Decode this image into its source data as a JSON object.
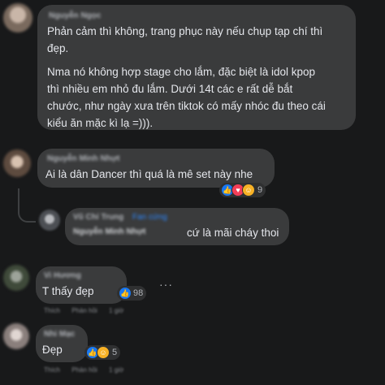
{
  "comments": [
    {
      "author": "Nguyễn Ngọc",
      "lines": [
        "Phản cảm thì không, trang phục này nếu chụp tạp chí thì",
        "đẹp.",
        "",
        "Nma nó không hợp stage cho lắm, đặc biệt là idol kpop",
        "thì nhiều em nhỏ đu lắm. Dưới 14t các e rất dễ bắt",
        "chước, như ngày xưa trên tiktok có mấy nhóc đu theo cái",
        "kiểu ăn mặc kì lạ =)))."
      ]
    },
    {
      "author": "Nguyễn Minh Nhựt",
      "text": "Ai là dân Dancer thì quá là mê set này nhe",
      "reaction_count": "9"
    },
    {
      "author": "Vũ Chí Trung",
      "author_badge": "Fan cứng",
      "mention": "Nguyễn Minh Nhựt",
      "text": "cứ là mãi cháy thoi"
    },
    {
      "author": "Vi Hương",
      "text": "T thấy đẹp",
      "reaction_count": "98",
      "actions": [
        "Thích",
        "Phản hồi",
        "1 giờ"
      ]
    },
    {
      "author": "Nhi Mạc",
      "text": "Đẹp",
      "reaction_count": "5",
      "actions": [
        "Thích",
        "Phản hồi",
        "1 giờ"
      ]
    }
  ],
  "more_options": "···",
  "icons": [
    "like-icon",
    "heart-icon",
    "care-icon"
  ],
  "colors": {
    "background": "#18191a",
    "bubble": "#3a3b3c",
    "like": "#1877f2",
    "heart": "#f33e58"
  }
}
